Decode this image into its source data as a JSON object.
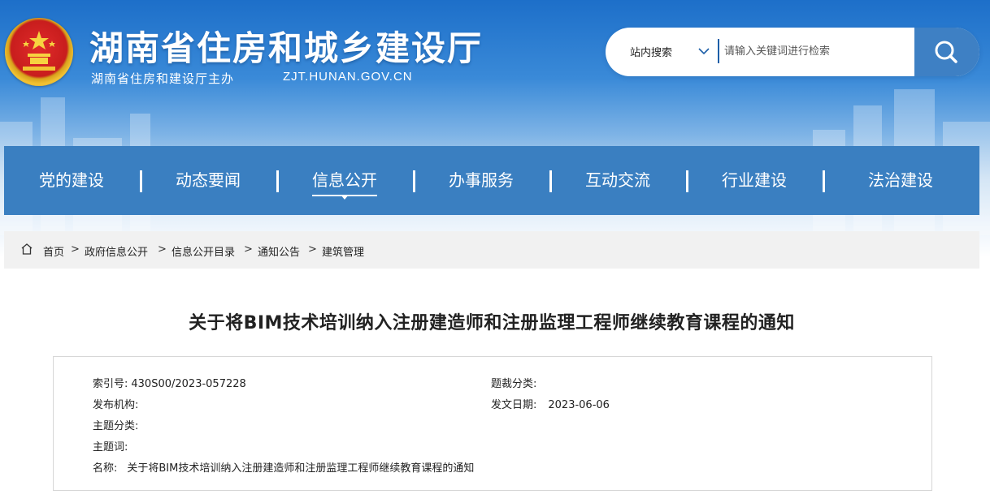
{
  "header": {
    "site_title": "湖南省住房和城乡建设厅",
    "site_sub": "湖南省住房和建设厅主办",
    "site_domain": "ZJT.HUNAN.GOV.CN",
    "emblem_icon": "national-emblem-icon"
  },
  "search": {
    "scope_label": "站内搜索",
    "placeholder": "请输入关键词进行检索",
    "button_icon": "search-icon"
  },
  "nav": {
    "items": [
      {
        "label": "党的建设"
      },
      {
        "label": "动态要闻"
      },
      {
        "label": "信息公开"
      },
      {
        "label": "办事服务"
      },
      {
        "label": "互动交流"
      },
      {
        "label": "行业建设"
      },
      {
        "label": "法治建设"
      }
    ],
    "active_index": 2
  },
  "breadcrumb": {
    "home_icon": "home-icon",
    "items": [
      "首页",
      "政府信息公开",
      "信息公开目录",
      "通知公告",
      "建筑管理"
    ],
    "separator": ">"
  },
  "article": {
    "title": "关于将BIM技术培训纳入注册建造师和注册监理工程师继续教育课程的通知"
  },
  "meta": {
    "index_label": "索引号:",
    "index_value": "430S00/2023-057228",
    "category_label": "题裁分类:",
    "category_value": "",
    "publisher_label": "发布机构:",
    "publisher_value": "",
    "date_label": "发文日期:",
    "date_value": "2023-06-06",
    "topic_label": "主题分类:",
    "topic_value": "",
    "keywords_label": "主题词:",
    "keywords_value": "",
    "name_label": "名称:",
    "name_value": "关于将BIM技术培训纳入注册建造师和注册监理工程师继续教育课程的通知"
  },
  "colors": {
    "brand_blue": "#3a7fc1",
    "search_button": "#3e80c4",
    "breadcrumb_bg": "#f1f1f1"
  }
}
